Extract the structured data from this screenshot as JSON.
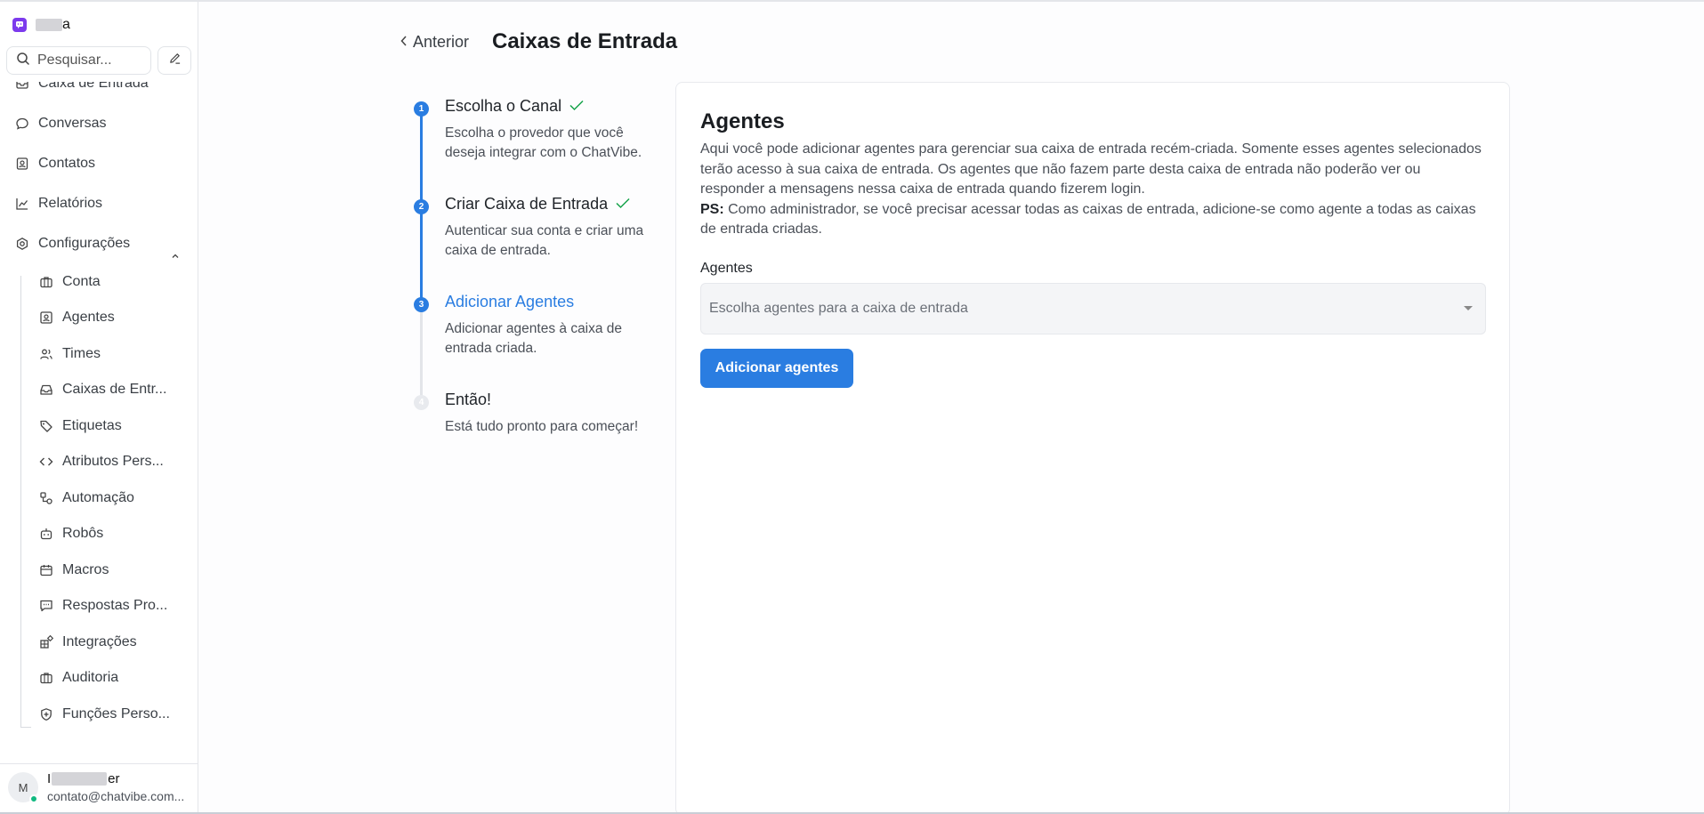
{
  "colors": {
    "accent": "#2a7de1",
    "success": "#16a34a",
    "brand": "#7c3aed",
    "online": "#10b981"
  },
  "brand": {
    "name_suffix": "a",
    "icon": "chat-bot-logo-icon"
  },
  "search": {
    "placeholder": "Pesquisar..."
  },
  "nav": {
    "items": [
      {
        "label": "Caixa de Entrada",
        "icon": "inbox-icon"
      },
      {
        "label": "Conversas",
        "icon": "chat-bubble-icon"
      },
      {
        "label": "Contatos",
        "icon": "contact-card-icon"
      },
      {
        "label": "Relatórios",
        "icon": "chart-line-icon"
      },
      {
        "label": "Configurações",
        "icon": "gear-icon"
      }
    ],
    "settings_items": [
      {
        "label": "Conta",
        "icon": "briefcase-icon"
      },
      {
        "label": "Agentes",
        "icon": "person-square-icon"
      },
      {
        "label": "Times",
        "icon": "people-icon"
      },
      {
        "label": "Caixas de Entr...",
        "icon": "inbox-tray-icon"
      },
      {
        "label": "Etiquetas",
        "icon": "tag-icon"
      },
      {
        "label": "Atributos Pers...",
        "icon": "code-icon"
      },
      {
        "label": "Automação",
        "icon": "automation-icon"
      },
      {
        "label": "Robôs",
        "icon": "robot-icon"
      },
      {
        "label": "Macros",
        "icon": "calendar-icon"
      },
      {
        "label": "Respostas Pro...",
        "icon": "canned-response-icon"
      },
      {
        "label": "Integrações",
        "icon": "puzzle-icon"
      },
      {
        "label": "Auditoria",
        "icon": "briefcase-icon"
      },
      {
        "label": "Funções Perso...",
        "icon": "shield-plus-icon"
      }
    ]
  },
  "profile": {
    "initial": "M",
    "name_prefix": "I",
    "name_suffix": "er",
    "email": "contato@chatvibe.com..."
  },
  "header": {
    "back_label": "Anterior",
    "title": "Caixas de Entrada"
  },
  "steps": [
    {
      "number": "1",
      "title": "Escolha o Canal",
      "description": "Escolha o provedor que você deseja integrar com o ChatVibe.",
      "status": "done"
    },
    {
      "number": "2",
      "title": "Criar Caixa de Entrada",
      "description": "Autenticar sua conta e criar uma caixa de entrada.",
      "status": "done"
    },
    {
      "number": "3",
      "title": "Adicionar Agentes",
      "description": "Adicionar agentes à caixa de entrada criada.",
      "status": "active"
    },
    {
      "number": "4",
      "title": "Então!",
      "description": "Está tudo pronto para começar!",
      "status": "pending"
    }
  ],
  "card": {
    "title": "Agentes",
    "description": "Aqui você pode adicionar agentes para gerenciar sua caixa de entrada recém-criada. Somente esses agentes selecionados terão acesso à sua caixa de entrada. Os agentes que não fazem parte desta caixa de entrada não poderão ver ou responder a mensagens nessa caixa de entrada quando fizerem login.",
    "ps_label": "PS:",
    "ps_text": " Como administrador, se você precisar acessar todas as caixas de entrada, adicione-se como agente a todas as caixas de entrada criadas.",
    "field_label": "Agentes",
    "select_placeholder": "Escolha agentes para a caixa de entrada",
    "submit_label": "Adicionar agentes"
  }
}
